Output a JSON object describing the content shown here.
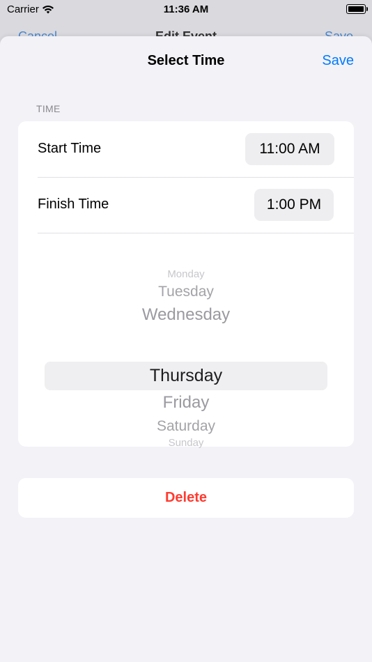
{
  "status_bar": {
    "carrier": "Carrier",
    "time": "11:36 AM"
  },
  "background_nav": {
    "cancel": "Cancel",
    "title": "Edit Event",
    "save": "Save"
  },
  "sheet": {
    "title": "Select Time",
    "save_label": "Save",
    "section_header": "TIME",
    "start": {
      "label": "Start Time",
      "value": "11:00 AM"
    },
    "finish": {
      "label": "Finish Time",
      "value": "1:00 PM"
    },
    "picker": {
      "items": [
        "Monday",
        "Tuesday",
        "Wednesday",
        "Thursday",
        "Friday",
        "Saturday",
        "Sunday"
      ],
      "selected": "Thursday"
    },
    "delete_label": "Delete"
  },
  "colors": {
    "accent": "#007aff",
    "destructive": "#ff3b30",
    "background": "#f2f2f7"
  }
}
